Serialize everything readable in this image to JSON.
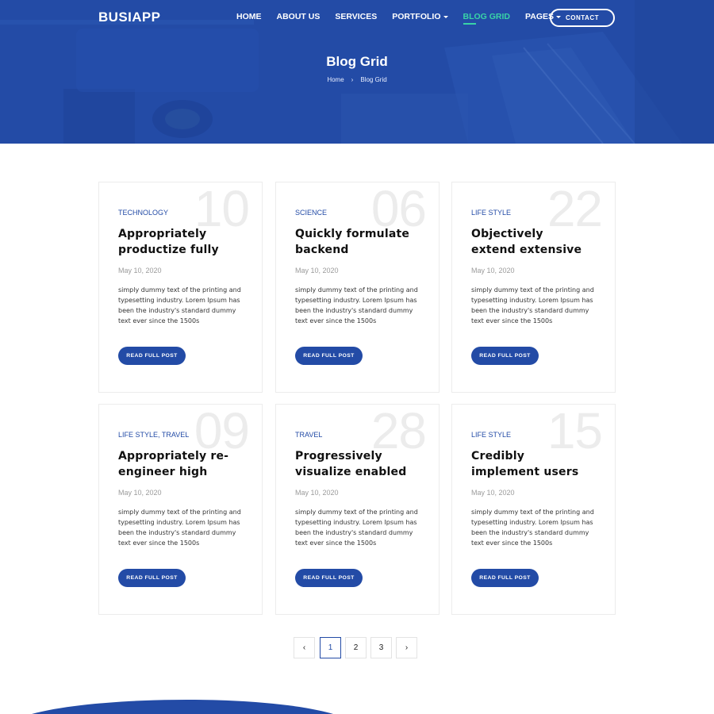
{
  "header": {
    "logo": "BUSIAPP",
    "nav": {
      "home": "HOME",
      "about": "ABOUT US",
      "services": "SERVICES",
      "portfolio": "PORTFOLIO",
      "blog_grid": "BLOG GRID",
      "pages": "PAGES"
    },
    "contact_label": "CONTACT",
    "accent_color": "#39d3a7",
    "brand_color": "#234ba6"
  },
  "hero": {
    "title": "Blog Grid",
    "breadcrumb": {
      "home": "Home",
      "separator": "›",
      "current": "Blog Grid"
    }
  },
  "posts": [
    {
      "number": "10",
      "category": "TECHNOLOGY",
      "title": "Appropriately productize fully",
      "date": "May 10, 2020",
      "excerpt": "simply dummy text of the printing and typesetting industry. Lorem Ipsum has been the industry's standard dummy text ever since the 1500s",
      "button": "READ FULL POST"
    },
    {
      "number": "06",
      "category": "SCIENCE",
      "title": "Quickly formulate backend",
      "date": "May 10, 2020",
      "excerpt": "simply dummy text of the printing and typesetting industry. Lorem Ipsum has been the industry's standard dummy text ever since the 1500s",
      "button": "READ FULL POST"
    },
    {
      "number": "22",
      "category": "LIFE STYLE",
      "title": "Objectively extend extensive",
      "date": "May 10, 2020",
      "excerpt": "simply dummy text of the printing and typesetting industry. Lorem Ipsum has been the industry's standard dummy text ever since the 1500s",
      "button": "READ FULL POST"
    },
    {
      "number": "09",
      "category": "LIFE STYLE, TRAVEL",
      "title": "Appropriately re-engineer high",
      "date": "May 10, 2020",
      "excerpt": "simply dummy text of the printing and typesetting industry. Lorem Ipsum has been the industry's standard dummy text ever since the 1500s",
      "button": "READ FULL POST"
    },
    {
      "number": "28",
      "category": "TRAVEL",
      "title": "Progressively visualize enabled",
      "date": "May 10, 2020",
      "excerpt": "simply dummy text of the printing and typesetting industry. Lorem Ipsum has been the industry's standard dummy text ever since the 1500s",
      "button": "READ FULL POST"
    },
    {
      "number": "15",
      "category": "LIFE STYLE",
      "title": "Credibly implement users",
      "date": "May 10, 2020",
      "excerpt": "simply dummy text of the printing and typesetting industry. Lorem Ipsum has been the industry's standard dummy text ever since the 1500s",
      "button": "READ FULL POST"
    }
  ],
  "pagination": {
    "prev_icon": "chevron-left-icon",
    "next_icon": "chevron-right-icon",
    "prev": "‹",
    "next": "›",
    "pages": [
      "1",
      "2",
      "3"
    ],
    "current": "1"
  }
}
